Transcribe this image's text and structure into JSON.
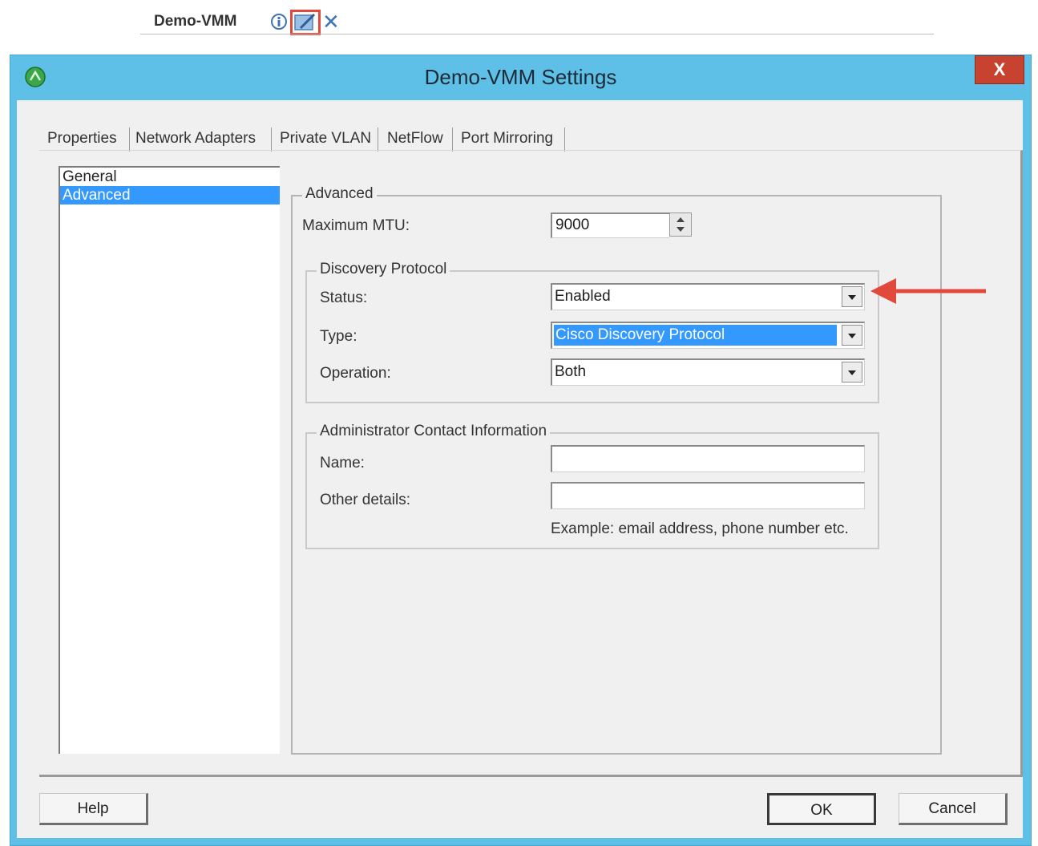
{
  "header": {
    "title": "Demo-VMM",
    "icons": [
      "info-icon",
      "edit-icon",
      "close-x-icon"
    ],
    "close_glyph": "✕"
  },
  "window": {
    "title": "Demo-VMM Settings",
    "close_label": "X",
    "title_bar_color": "#5ec0e6",
    "close_color": "#c8432f"
  },
  "tabs": [
    {
      "label": "Properties",
      "active": true
    },
    {
      "label": "Network Adapters"
    },
    {
      "label": "Private VLAN"
    },
    {
      "label": "NetFlow"
    },
    {
      "label": "Port Mirroring"
    }
  ],
  "nav": {
    "items": [
      {
        "label": "General"
      },
      {
        "label": "Advanced",
        "selected": true
      }
    ]
  },
  "advanced": {
    "legend": "Advanced",
    "mtu_label": "Maximum MTU:",
    "mtu_value": "9000",
    "discovery": {
      "legend": "Discovery Protocol",
      "status_label": "Status:",
      "status_value": "Enabled",
      "type_label": "Type:",
      "type_value": "Cisco Discovery Protocol",
      "operation_label": "Operation:",
      "operation_value": "Both"
    },
    "admin": {
      "legend": "Administrator Contact Information",
      "name_label": "Name:",
      "name_value": "",
      "other_label": "Other details:",
      "other_value": "",
      "hint": "Example: email address, phone number etc."
    }
  },
  "buttons": {
    "help": "Help",
    "ok": "OK",
    "cancel": "Cancel"
  },
  "colors": {
    "selection": "#3399ff",
    "annotation": "#e2493d"
  }
}
